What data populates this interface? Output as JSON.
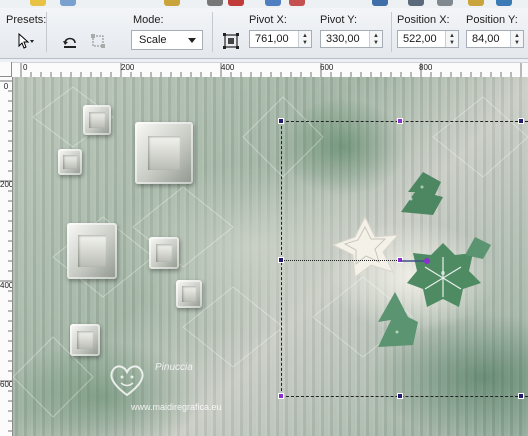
{
  "toolbar": {
    "presets_label": "Presets:",
    "mode_label": "Mode:",
    "mode_value": "Scale",
    "pivot_x_label": "Pivot X:",
    "pivot_x_value": "761,00",
    "pivot_y_label": "Pivot Y:",
    "pivot_y_value": "330,00",
    "position_x_label": "Position X:",
    "position_x_value": "522,00",
    "position_y_label": "Position Y:",
    "position_y_value": "84,00"
  },
  "ruler": {
    "top_labels": [
      "0",
      "200",
      "400",
      "600",
      "800"
    ],
    "left_labels": [
      "0",
      "200",
      "400",
      "600"
    ]
  },
  "watermark": {
    "name": "Pinuccia",
    "url": "www.maidiregrafica.eu"
  },
  "colors": {
    "selection_handle": "#231a6e",
    "rotate_handle": "#8c2fd1",
    "canvas_green": "#5f8d6d"
  }
}
